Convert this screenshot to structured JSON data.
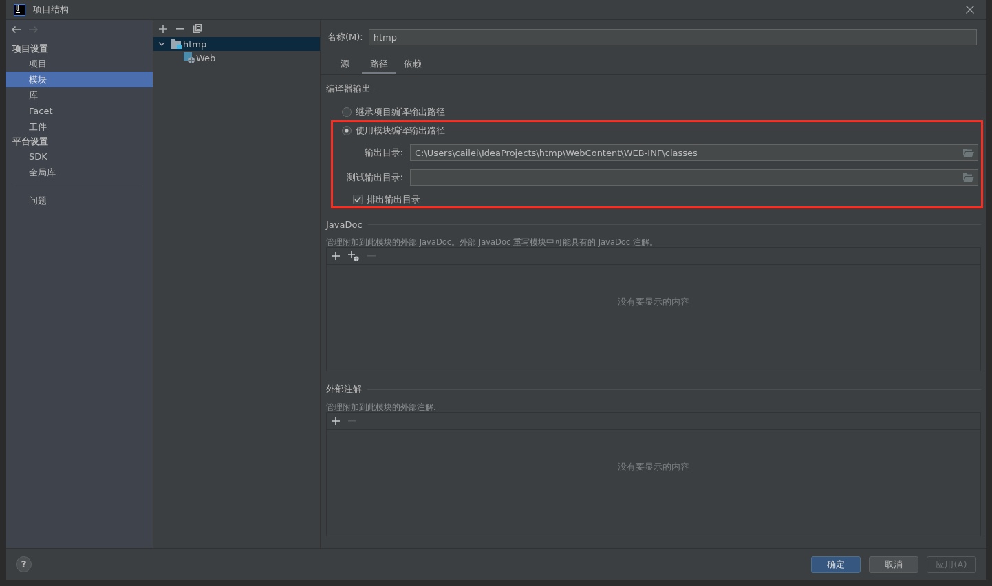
{
  "window": {
    "logo": "IJ",
    "title": "项目结构"
  },
  "history": [
    {
      "kind": "back",
      "disabled": false
    },
    {
      "kind": "forward",
      "disabled": true
    }
  ],
  "nav": {
    "sections": [
      {
        "header": "项目设置",
        "items": [
          {
            "label": "项目",
            "selected": false
          },
          {
            "label": "模块",
            "selected": true
          },
          {
            "label": "库",
            "selected": false
          },
          {
            "label": "Facet",
            "selected": false
          },
          {
            "label": "工件",
            "selected": false
          }
        ]
      },
      {
        "header": "平台设置",
        "items": [
          {
            "label": "SDK",
            "selected": false
          },
          {
            "label": "全局库",
            "selected": false
          }
        ]
      }
    ],
    "extra_items": [
      {
        "label": "问题",
        "selected": false
      }
    ]
  },
  "module_tree": [
    {
      "label": "htmp",
      "kind": "module",
      "expanded": true,
      "selected": true,
      "children": [
        {
          "label": "Web",
          "kind": "web",
          "selected": false
        }
      ]
    }
  ],
  "name_field": {
    "label": "名称(M):",
    "value": "htmp"
  },
  "tabs": [
    {
      "label": "源",
      "selected": false
    },
    {
      "label": "路径",
      "selected": true
    },
    {
      "label": "依赖",
      "selected": false
    }
  ],
  "compiler_output": {
    "title": "编译器输出",
    "highlighted": true,
    "options": [
      {
        "label": "继承项目编译输出路径",
        "selected": false
      },
      {
        "label": "使用模块编译输出路径",
        "selected": true
      }
    ],
    "paths": [
      {
        "label": "输出目录:",
        "value": "C:\\Users\\cailei\\IdeaProjects\\htmp\\WebContent\\WEB-INF\\classes"
      },
      {
        "label": "测试输出目录:"
      }
    ],
    "exclude": {
      "label": "排出输出目录",
      "checked": true
    }
  },
  "javadoc": {
    "title": "JavaDoc",
    "description": "管理附加到此模块的外部 JavaDoc。外部 JavaDoc 重写模块中可能具有的 JavaDoc 注解。",
    "toolbar": [
      {
        "kind": "add",
        "disabled": false
      },
      {
        "kind": "add_url",
        "disabled": false
      },
      {
        "kind": "remove",
        "disabled": true
      }
    ],
    "empty_text": "没有要显示的内容"
  },
  "external_annotations": {
    "title": "外部注解",
    "description": "管理附加到此模块的外部注解.",
    "toolbar": [
      {
        "kind": "add",
        "disabled": false
      },
      {
        "kind": "remove",
        "disabled": true
      }
    ],
    "empty_text": "没有要显示的内容"
  },
  "help": "?",
  "buttons": [
    {
      "label": "确定",
      "kind": "primary",
      "disabled": false
    },
    {
      "label": "取消",
      "kind": "normal",
      "disabled": false
    },
    {
      "label": "应用(A)",
      "kind": "normal",
      "disabled": true
    }
  ]
}
